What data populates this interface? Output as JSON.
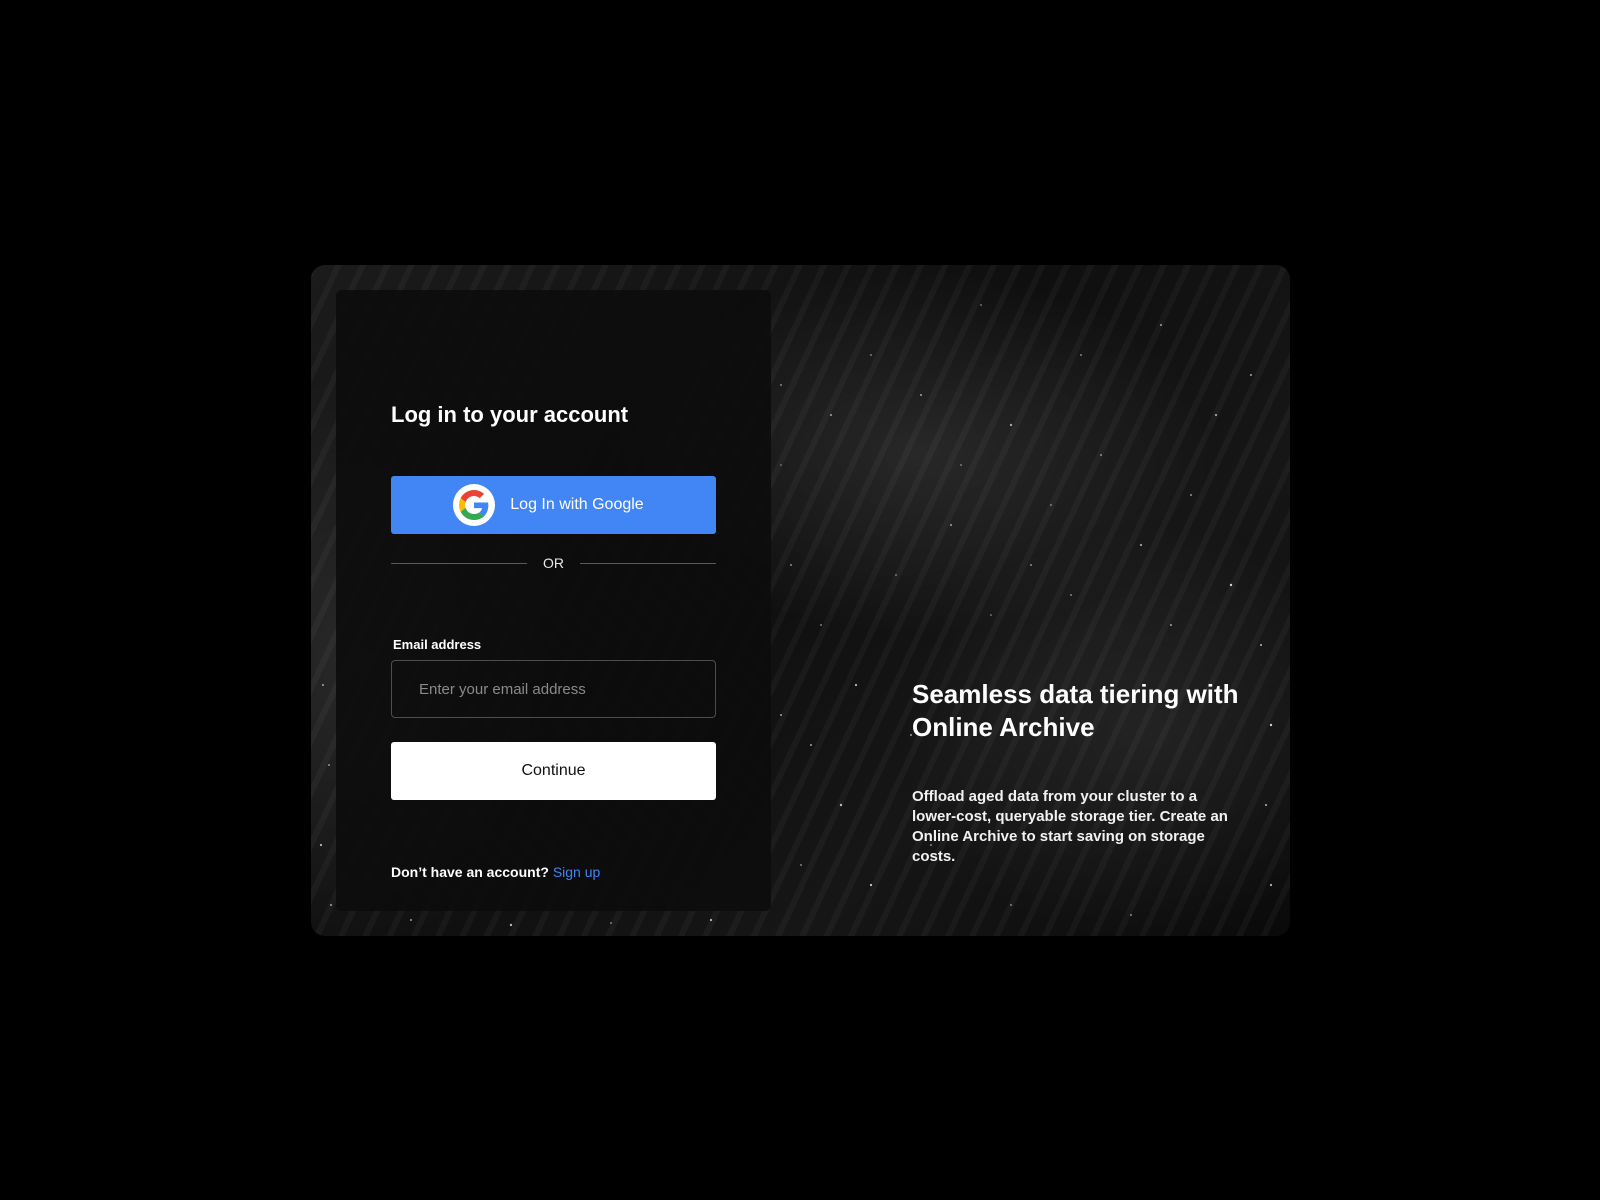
{
  "login": {
    "title": "Log in to your account",
    "google_button_label": "Log In with Google",
    "google_icon": "google-icon",
    "divider_text": "OR",
    "email_label": "Email address",
    "email_placeholder": "Enter your email address",
    "email_value": "",
    "continue_label": "Continue",
    "signup_prompt": "Don’t have an account?",
    "signup_link": "Sign up"
  },
  "promo": {
    "title": "Seamless data tiering with Online Archive",
    "body": "Offload aged data from your cluster to a lower-cost, queryable storage tier. Create an Online Archive to start saving on storage costs."
  },
  "colors": {
    "page_background": "#000000",
    "google_button": "#4285f4",
    "link": "#4285f4",
    "continue_button": "#ffffff"
  }
}
